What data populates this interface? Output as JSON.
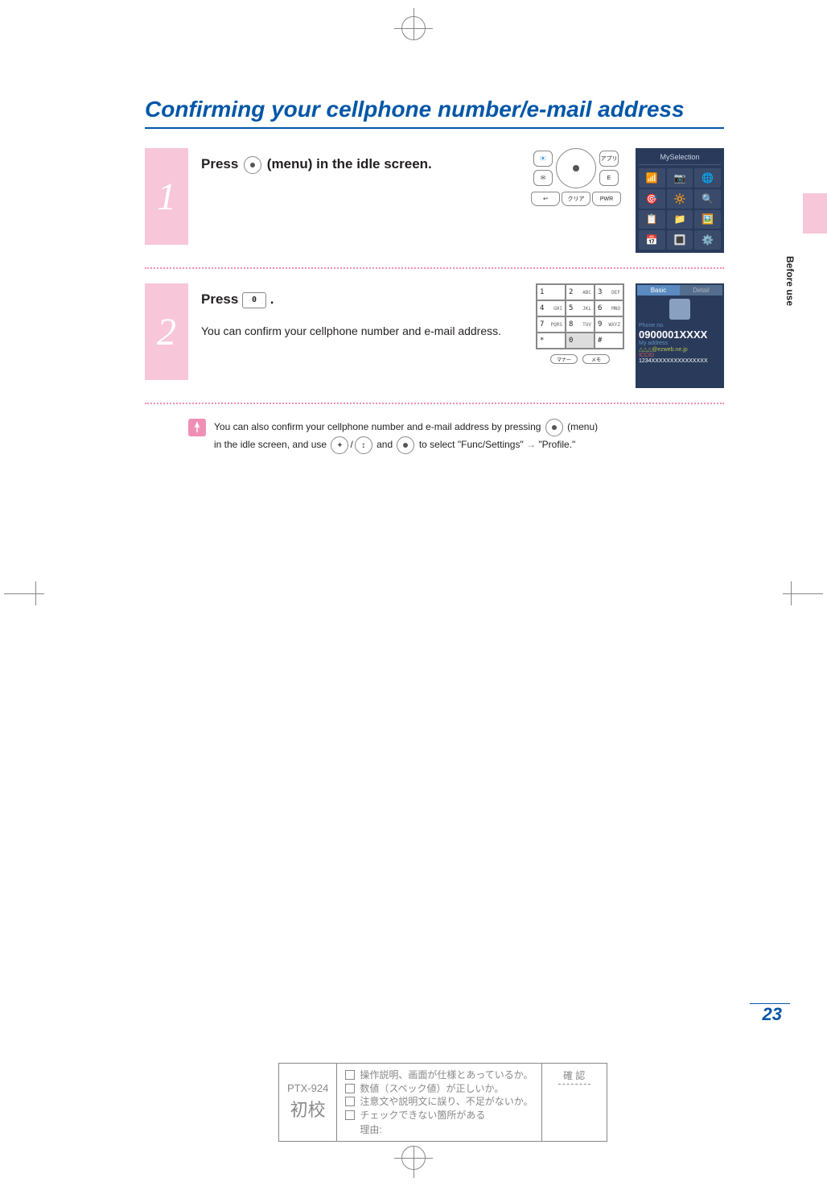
{
  "title": "Confirming your cellphone number/e-mail address",
  "side_tab": "Before use",
  "page_number": "23",
  "steps": [
    {
      "num": "1",
      "head_pre": "Press ",
      "head_post": " (menu) in the idle screen.",
      "body": ""
    },
    {
      "num": "2",
      "head_pre": "Press ",
      "head_key": "0",
      "head_post": " .",
      "body": "You can confirm your cellphone number and e-mail address."
    }
  ],
  "myselection": {
    "header": "MySelection",
    "icons": [
      "📶",
      "📷",
      "🌐",
      "🎯",
      "🔆",
      "🔍",
      "📋",
      "📁",
      "🖼️",
      "📅",
      "🔳",
      "⚙️"
    ]
  },
  "phone_buttons": {
    "top_left": "📧",
    "top_right": "アプリ",
    "mid_left": "✉",
    "mid_right": "E",
    "bot_left": "↩",
    "bot_mid": "クリア",
    "bot_right": "PWR"
  },
  "keypad": {
    "keys": [
      [
        "1",
        ""
      ],
      [
        "2",
        "ABC"
      ],
      [
        "3",
        "DEF"
      ],
      [
        "4",
        "GHI"
      ],
      [
        "5",
        "JKL"
      ],
      [
        "6",
        "MNO"
      ],
      [
        "7",
        "PQRS"
      ],
      [
        "8",
        "TUV"
      ],
      [
        "9",
        "WXYZ"
      ],
      [
        "*",
        ""
      ],
      [
        "0",
        ""
      ],
      [
        "#",
        ""
      ]
    ],
    "bottom_left": "マナー",
    "bottom_right": "メモ"
  },
  "profile": {
    "tab_active": "Basic",
    "tab_inactive": "Detail",
    "label_phone": "Phone no.",
    "number": "0900001XXXX",
    "label_addr": "My address",
    "address": "△△△@ezweb.ne.jp",
    "iccid_label": "ICCID",
    "iccid": "1234XXXXXXXXXXXXXXX"
  },
  "tip": {
    "line1_pre": "You can also confirm your cellphone number and e-mail address by pressing ",
    "line1_post": "(menu)",
    "line2_pre": "in the idle screen, and use ",
    "line2_mid": " and ",
    "line2_sel_pre": " to select \"Func/Settings\" ",
    "line2_arrow": "→",
    "line2_sel_post": " \"Profile.\""
  },
  "proof": {
    "code": "PTX-924",
    "stage": "初校",
    "checks": [
      "操作説明、画面が仕様とあっているか。",
      "数値（スペック値）が正しいか。",
      "注意文や説明文に誤り、不足がないか。",
      "チェックできない箇所がある"
    ],
    "reason_label": "理由:",
    "confirm": "確 認"
  }
}
